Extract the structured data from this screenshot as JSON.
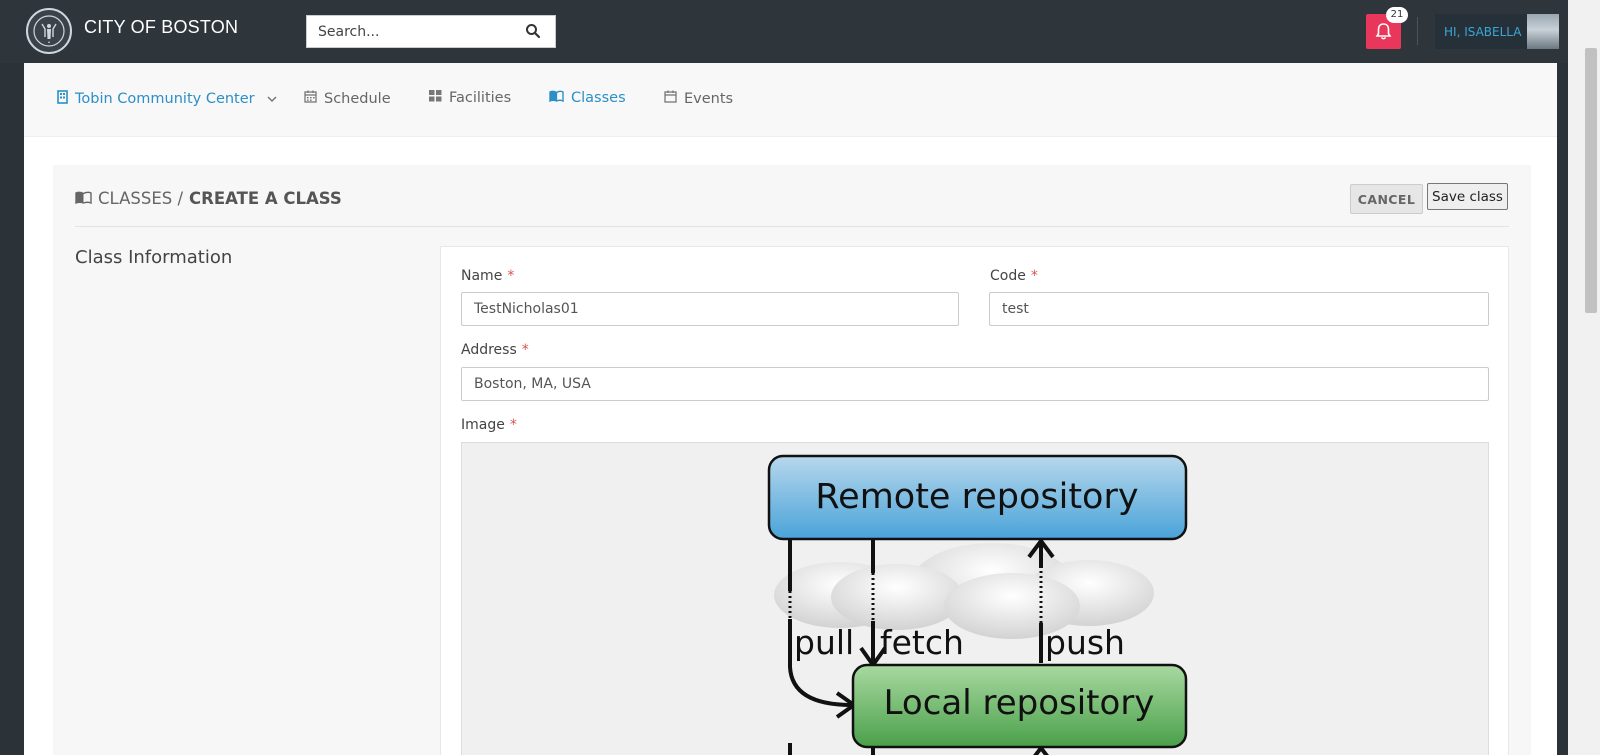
{
  "header": {
    "city_name": "CITY OF BOSTON",
    "search_placeholder": "Search...",
    "notification_count": "21",
    "greeting": "HI, ISABELLA"
  },
  "nav": {
    "location": "Tobin Community Center",
    "items": [
      {
        "label": "Schedule",
        "icon": "calendar-icon"
      },
      {
        "label": "Facilities",
        "icon": "grid-icon"
      },
      {
        "label": "Classes",
        "icon": "book-icon",
        "active": true
      },
      {
        "label": "Events",
        "icon": "calendar-icon"
      }
    ]
  },
  "page": {
    "breadcrumb_parent": "CLASSES /",
    "breadcrumb_current": "CREATE A CLASS",
    "cancel_label": "CANCEL",
    "save_label": "Save class",
    "section_title": "Class Information"
  },
  "form": {
    "name_label": "Name",
    "name_value": "TestNicholas01",
    "code_label": "Code",
    "code_value": "test",
    "address_label": "Address",
    "address_value": "Boston, MA, USA",
    "image_label": "Image",
    "required_mark": "*"
  },
  "image_diagram": {
    "remote": "Remote repository",
    "local": "Local repository",
    "pull": "pull",
    "fetch": "fetch",
    "push": "push"
  },
  "colors": {
    "accent": "#2c8fc7",
    "topbar": "#2e353b",
    "notification": "#e8375a",
    "required": "#d9534f"
  }
}
